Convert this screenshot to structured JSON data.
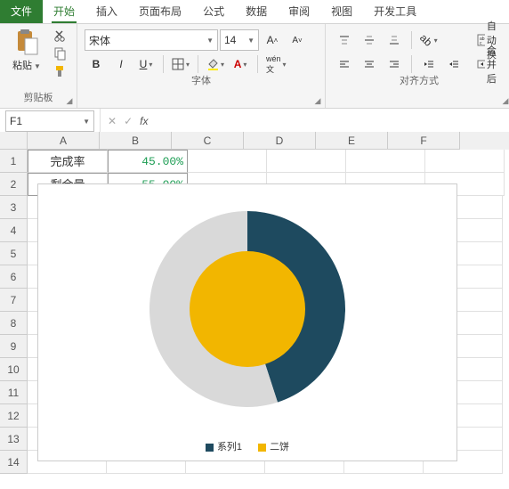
{
  "menu": {
    "file": "文件",
    "home": "开始",
    "insert": "插入",
    "layout": "页面布局",
    "formula": "公式",
    "data": "数据",
    "review": "审阅",
    "view": "视图",
    "dev": "开发工具"
  },
  "ribbon": {
    "clipboard": {
      "paste": "粘贴",
      "label": "剪贴板"
    },
    "font": {
      "name": "宋体",
      "size": "14",
      "label": "字体"
    },
    "align": {
      "wrap": "自动换",
      "merge": "合并后",
      "label": "对齐方式"
    }
  },
  "namebox": "F1",
  "fx": "",
  "cols": [
    "A",
    "B",
    "C",
    "D",
    "E",
    "F"
  ],
  "rows": [
    "1",
    "2",
    "3",
    "4",
    "5",
    "6",
    "7",
    "8",
    "9",
    "10",
    "11",
    "12",
    "13",
    "14"
  ],
  "cells": {
    "A1": "完成率",
    "B1": "45.00%",
    "A2": "剩余量",
    "B2": "55.00%"
  },
  "chart_data": {
    "type": "pie",
    "title": "",
    "series": [
      {
        "name": "系列1",
        "values": [
          {
            "label": "完成率",
            "value": 45,
            "color": "#1e4a5f"
          },
          {
            "label": "剩余量",
            "value": 55,
            "color": "#d9d9d9"
          }
        ]
      },
      {
        "name": "二饼",
        "values": [
          {
            "label": "",
            "value": 100,
            "color": "#f2b600"
          }
        ]
      }
    ],
    "legend": [
      "系列1",
      "二饼"
    ],
    "legend_colors": [
      "#1e4a5f",
      "#f2b600"
    ]
  }
}
